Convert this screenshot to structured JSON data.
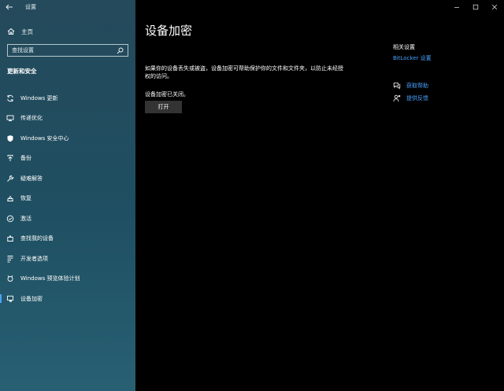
{
  "window": {
    "title": "设置",
    "controls": [
      "minimize",
      "maximize",
      "close"
    ]
  },
  "sidebar": {
    "home_label": "主页",
    "search_placeholder": "查找设置",
    "section_title": "更新和安全",
    "items": [
      {
        "label": "Windows 更新",
        "icon": "sync-icon"
      },
      {
        "label": "传递优化",
        "icon": "delivery-optimization-icon"
      },
      {
        "label": "Windows 安全中心",
        "icon": "shield-icon"
      },
      {
        "label": "备份",
        "icon": "backup-icon"
      },
      {
        "label": "疑难解答",
        "icon": "wrench-icon"
      },
      {
        "label": "恢复",
        "icon": "recovery-icon"
      },
      {
        "label": "激活",
        "icon": "activation-icon"
      },
      {
        "label": "查找我的设备",
        "icon": "find-device-icon"
      },
      {
        "label": "开发者选项",
        "icon": "developer-icon"
      },
      {
        "label": "Windows 预览体验计划",
        "icon": "insider-icon"
      },
      {
        "label": "设备加密",
        "icon": "device-encryption-icon",
        "active": true
      }
    ]
  },
  "main": {
    "title": "设备加密",
    "description": "如果你的设备丢失或被盗，设备加密可帮助保护你的文件和文件夹，以防止未经授权的访问。",
    "status": "设备加密已关闭。",
    "button_label": "打开"
  },
  "related": {
    "title": "相关设置",
    "link": "BitLocker 设置",
    "help_label": "获取帮助",
    "feedback_label": "提供反馈"
  },
  "colors": {
    "sidebar_bg": "#1f4f62",
    "main_bg": "#000000",
    "accent": "#4aa3ff",
    "button_bg": "#333333"
  }
}
